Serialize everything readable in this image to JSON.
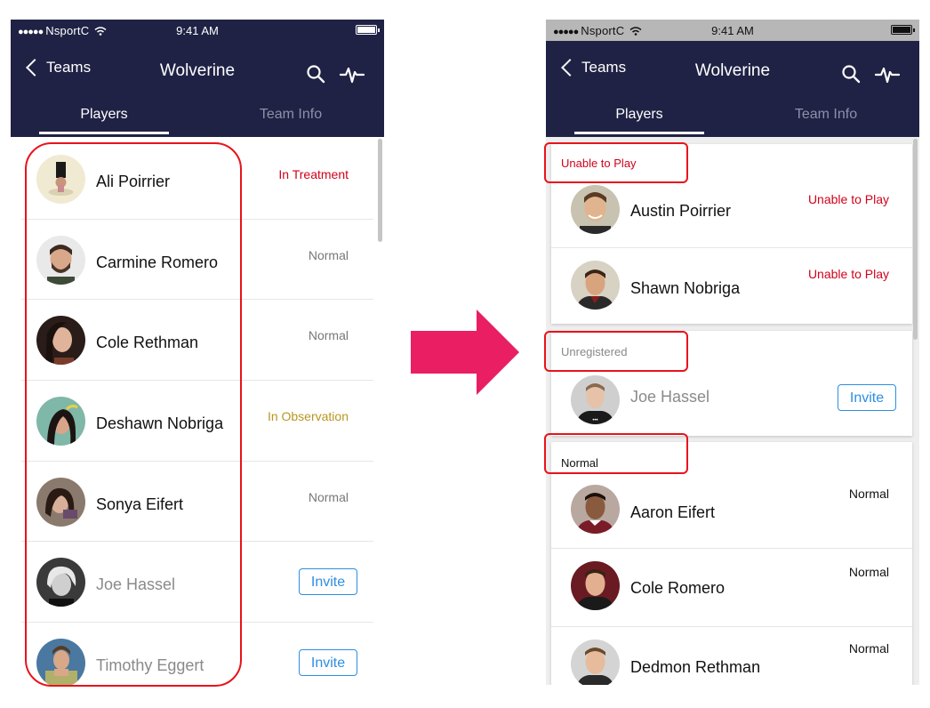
{
  "status_bar": {
    "carrier": "NsportC",
    "time": "9:41 AM"
  },
  "nav": {
    "back_label": "Teams",
    "title": "Wolverine"
  },
  "tabs": [
    {
      "label": "Players"
    },
    {
      "label": "Team Info"
    }
  ],
  "left_screen": {
    "players": [
      {
        "name": "Ali Poirrier",
        "status": "In Treatment"
      },
      {
        "name": "Carmine Romero",
        "status": "Normal"
      },
      {
        "name": "Cole Rethman",
        "status": "Normal"
      },
      {
        "name": "Deshawn Nobriga",
        "status": "In Observation"
      },
      {
        "name": "Sonya Eifert",
        "status": "Normal"
      },
      {
        "name": "Joe Hassel",
        "action": "Invite"
      },
      {
        "name": "Timothy Eggert",
        "action": "Invite"
      }
    ]
  },
  "right_screen": {
    "groups": [
      {
        "header": "Unable to Play",
        "players": [
          {
            "name": "Austin Poirrier",
            "status": "Unable to Play"
          },
          {
            "name": "Shawn Nobriga",
            "status": "Unable to Play"
          }
        ]
      },
      {
        "header": "Unregistered",
        "players": [
          {
            "name": "Joe Hassel",
            "action": "Invite"
          }
        ]
      },
      {
        "header": "Normal",
        "players": [
          {
            "name": "Aaron Eifert",
            "status": "Normal"
          },
          {
            "name": "Cole Romero",
            "status": "Normal"
          },
          {
            "name": "Dedmon Rethman",
            "status": "Normal"
          }
        ]
      }
    ]
  },
  "colors": {
    "nav_bg": "#1f2244",
    "treatment": "#d0021b",
    "observation": "#b8971f",
    "invite": "#2d8ee2",
    "highlight_box": "#e8131b",
    "arrow": "#e91e63"
  }
}
